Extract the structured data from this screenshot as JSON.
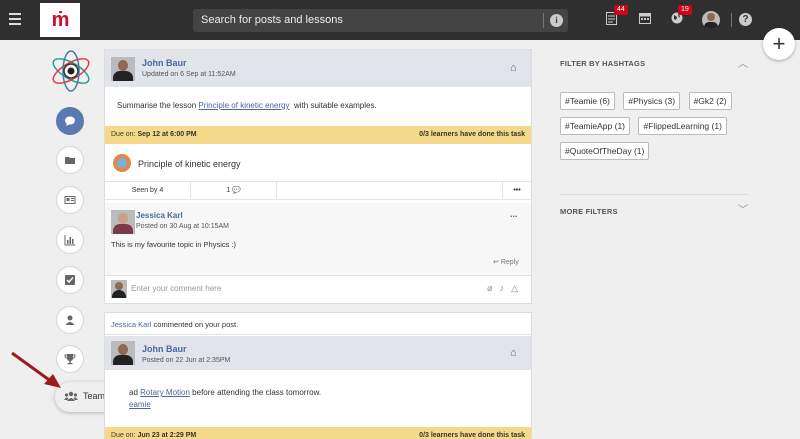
{
  "topbar": {
    "search_placeholder": "Search for posts and lessons",
    "notifications": [
      {
        "icon": "document-icon",
        "badge": "44"
      },
      {
        "icon": "calendar-icon",
        "badge": ""
      },
      {
        "icon": "globe-icon",
        "badge": "19"
      }
    ],
    "help_glyph": "?",
    "info_glyph": "i"
  },
  "fab": {
    "glyph": "+"
  },
  "sidebar": {
    "items": [
      {
        "name": "chat-icon",
        "active": true
      },
      {
        "name": "folder-icon",
        "active": false
      },
      {
        "name": "news-icon",
        "active": false
      },
      {
        "name": "bar-chart-icon",
        "active": false
      },
      {
        "name": "checkbox-icon",
        "active": false
      },
      {
        "name": "user-icon",
        "active": false
      },
      {
        "name": "trophy-icon",
        "active": false
      }
    ],
    "teams_label": "Teams"
  },
  "post1": {
    "author": "John Baur",
    "updated": "Updated on 6 Sep at 11:52AM",
    "text_before": "Summarise the lesson",
    "link": "Principle of kinetic energy",
    "text_after": "with suitable examples.",
    "due_label": "Due on:",
    "due_date": "Sep 12 at 6:00 PM",
    "learners": "0/3 learners have done this task",
    "lesson_title": "Principle of kinetic energy",
    "seen_by": "Seen by 4",
    "comment_count": "1",
    "more": "•••",
    "comment": {
      "author": "Jessica Karl",
      "posted": "Posted on 30 Aug at 10:15AM",
      "text": "This is my favourite topic in Physics :)",
      "reply": "Reply",
      "more": "..."
    },
    "comment_placeholder": "Enter your comment here"
  },
  "post2": {
    "notice_user": "Jessica Karl",
    "notice_text": "commented on your post.",
    "author": "John Baur",
    "posted": "Posted on 22 Jun at 2:35PM",
    "text_before": "ad",
    "link": "Rotary Motion",
    "text_after": "before attending the class tomorrow.",
    "hashtag": "eamie",
    "due_label": "Due on:",
    "due_date": "Jun 23 at 2:29 PM",
    "learners": "0/3 learners have done this task"
  },
  "right": {
    "filter_title": "FILTER BY HASHTAGS",
    "tags": [
      "#Teamie (6)",
      "#Physics (3)",
      "#Gk2 (2)",
      "#TeamieApp (1)",
      "#FlippedLearning (1)",
      "#QuoteOfTheDay (1)"
    ],
    "more_filters": "MORE FILTERS"
  },
  "colors": {
    "accent": "#4a67a1",
    "topbar": "#2f2f2f",
    "due": "#f5d98b",
    "badge": "#d0021b",
    "active": "#5a7bb0"
  }
}
